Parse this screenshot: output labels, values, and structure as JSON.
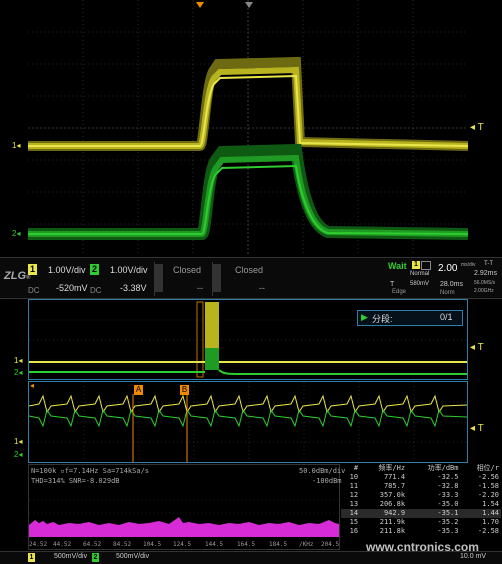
{
  "trigger_label": "T",
  "ch1_marker": "1",
  "ch2_marker": "2",
  "ch1": {
    "id": "1",
    "scale": "1.00V/div",
    "offset": "-520mV",
    "coupling": "DC"
  },
  "ch2": {
    "id": "2",
    "scale": "1.00V/div",
    "offset": "-3.38V",
    "coupling": "DC"
  },
  "ch3": {
    "label": "Closed",
    "value": "--"
  },
  "ch4": {
    "label": "Closed",
    "value": "--"
  },
  "acq": {
    "state": "Wait",
    "mode": "Normal",
    "trig_type": "Edge",
    "trig_level": "580mV",
    "trig_ch": "1"
  },
  "timebase": {
    "scale": "2.00",
    "unit": "ms/div",
    "delay": "28.0ms",
    "mode": "Norm"
  },
  "sample": {
    "header": "T-T",
    "time": "2.92ms",
    "rate": "56.0MS/s",
    "bw": "2.00GHz"
  },
  "segment": {
    "label": "分段:",
    "count": "0/1"
  },
  "cursor_a": "A",
  "cursor_b": "B",
  "fft": {
    "line1": "N=100k  ▫f=7.14Hz  Sa=714kSa/s",
    "line2": "THD=314%  SNR=-8.029dB",
    "ref_scale": "50.0dBm/div",
    "ref_level": "-100dBm",
    "x_ticks": [
      "24.52",
      "44.52",
      "64.52",
      "84.52",
      "104.5",
      "124.5",
      "144.5",
      "164.5",
      "184.5"
    ],
    "x_unit": "/KHz",
    "x_end": "204.5"
  },
  "fft_table": {
    "headers": [
      "#",
      "频率/Hz",
      "功率/dBm",
      "相位/r"
    ],
    "rows": [
      [
        "10",
        "771.4",
        "-32.5",
        "-2.56"
      ],
      [
        "11",
        "785.7",
        "-32.8",
        "-1.58"
      ],
      [
        "12",
        "357.0k",
        "-33.3",
        "-2.20"
      ],
      [
        "13",
        "206.8k",
        "-35.0",
        "1.54"
      ],
      [
        "14",
        "942.9",
        "-35.1",
        "1.44"
      ],
      [
        "15",
        "211.9k",
        "-35.2",
        "1.70"
      ],
      [
        "16",
        "211.8k",
        "-35.3",
        "-2.58"
      ]
    ]
  },
  "bottom_bar": {
    "ch1_scale": "500mV/div",
    "ch2_scale": "500mV/div",
    "right": "10.0 mV"
  },
  "watermark": "www.cntronics.com",
  "colors": {
    "ch1": "#e8e64a",
    "ch2": "#2ecc2e",
    "math": "#d62bd6",
    "accent": "#f08a00",
    "border": "#2f7fa8"
  }
}
